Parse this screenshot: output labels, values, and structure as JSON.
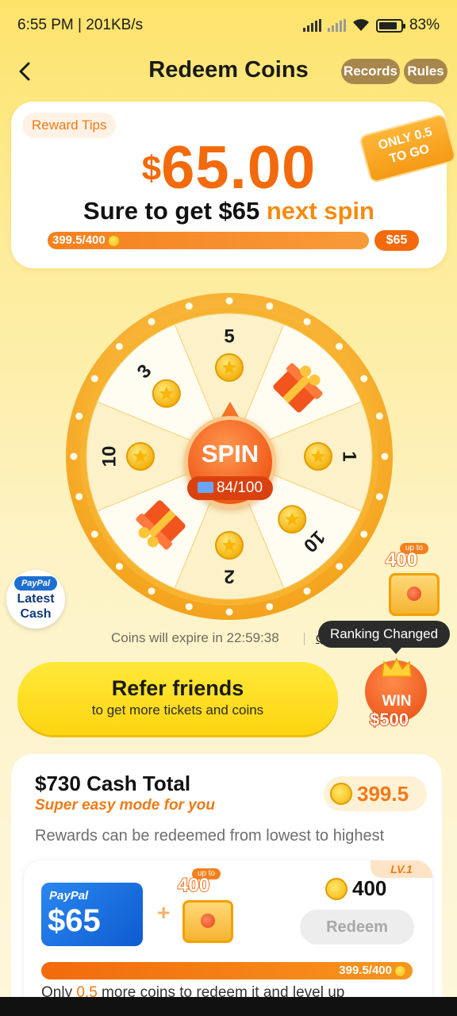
{
  "status_bar": {
    "time_speed": "6:55 PM | 201KB/s",
    "battery": "83%"
  },
  "header": {
    "title": "Redeem Coins",
    "records": "Records",
    "rules": "Rules"
  },
  "reward": {
    "tip": "Reward Tips",
    "currency": "$",
    "amount": "65.00",
    "sure_prefix": "Sure to get $65 ",
    "sure_highlight": "next spin",
    "progress_label": "399.5/400",
    "progress_fraction": 0.99875,
    "progress_end": "$65",
    "only_line1": "ONLY 0.5",
    "only_line2": "TO GO"
  },
  "wheel": {
    "segments": [
      "5",
      "gift",
      "1",
      "10",
      "2",
      "gift",
      "10",
      "3"
    ],
    "spin_label": "SPIN",
    "tickets": "84/100"
  },
  "paypal_badge": {
    "brand": "PayPal",
    "line1": "Latest",
    "line2": "Cash"
  },
  "chest_widget": {
    "upto": "up to",
    "value": "400"
  },
  "ranking_tip": "Ranking Changed",
  "expire": "Coins will expire in 22:59:38",
  "qa": "Q&A",
  "win_widget": {
    "label": "WIN",
    "amount": "$500"
  },
  "refer": {
    "title": "Refer friends",
    "subtitle": "to get more tickets and coins"
  },
  "cash": {
    "title": "$730 Cash Total",
    "subtitle": "Super easy mode for you",
    "coins": "399.5",
    "note": "Rewards can be redeemed from lowest to highest",
    "level": {
      "tag": "LV.1",
      "card_brand": "PayPal",
      "card_amount": "$65",
      "chest_upto": "up to",
      "chest_value": "400",
      "price": "400",
      "redeem": "Redeem",
      "progress": "399.5/400",
      "note_prefix": "Only ",
      "note_hl": "0.5",
      "note_suffix": " more coins to redeem it and level up"
    }
  },
  "colors": {
    "accent": "#f26a0c",
    "highlight": "#f58a10",
    "yellow": "#fdd510",
    "paypal": "#1f6fd1"
  }
}
